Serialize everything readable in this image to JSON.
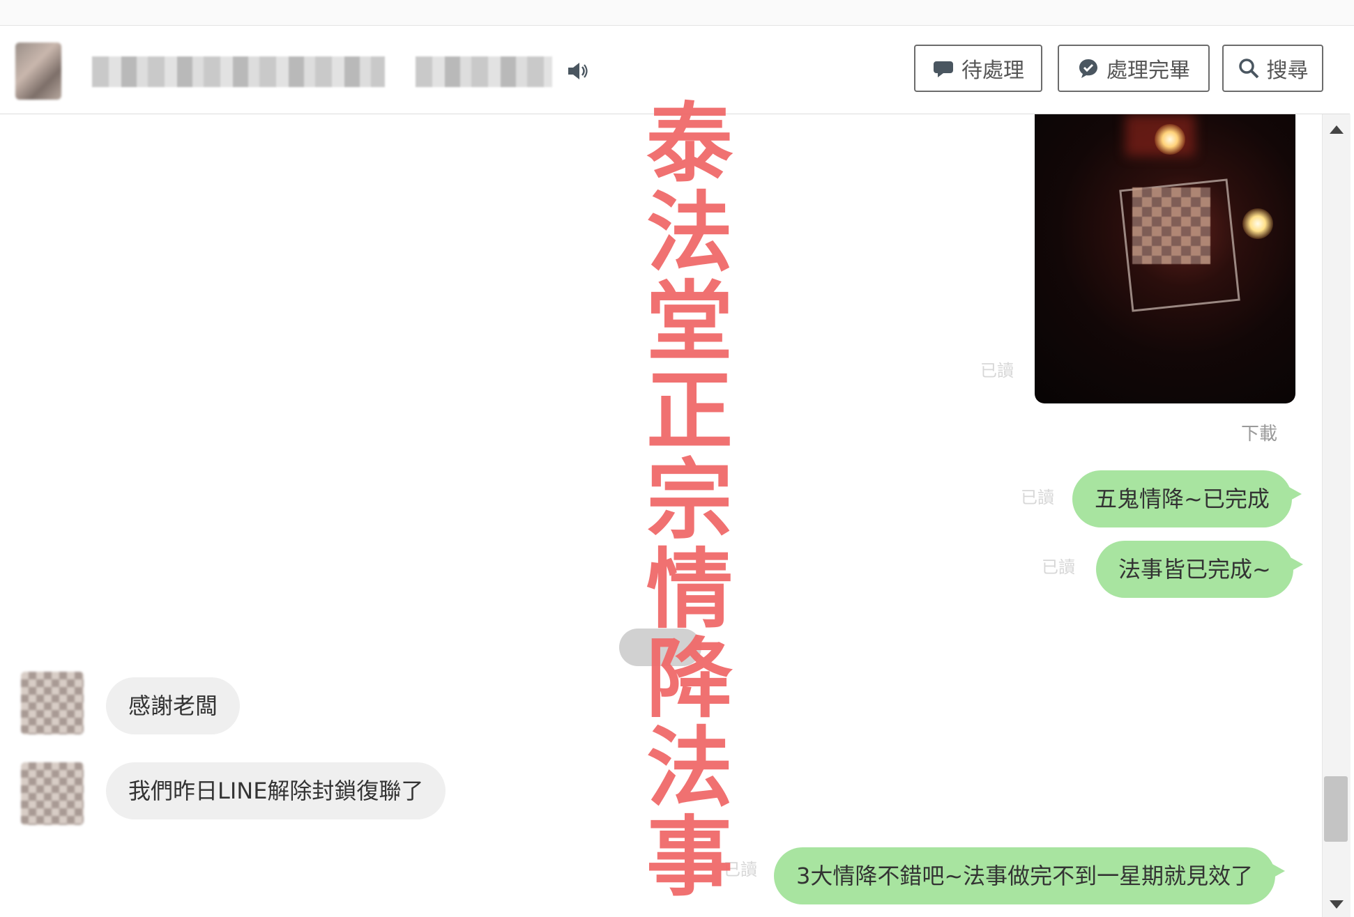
{
  "header": {
    "buttons": [
      {
        "label": "待處理",
        "icon": "chat-bubble-icon"
      },
      {
        "label": "處理完畢",
        "icon": "chat-check-icon"
      },
      {
        "label": "搜尋",
        "icon": "search-icon"
      }
    ]
  },
  "chat": {
    "download_label": "下載",
    "read_label": "已讀",
    "messages": [
      {
        "side": "out",
        "text": "五鬼情降~已完成"
      },
      {
        "side": "out",
        "text": "法事皆已完成~"
      },
      {
        "side": "in",
        "text": "感謝老闆"
      },
      {
        "side": "in",
        "text": "我們昨日LINE解除封鎖復聯了"
      },
      {
        "side": "out",
        "text": "3大情降不錯吧~法事做完不到一星期就見效了"
      }
    ]
  },
  "watermark": {
    "text": "泰法堂正宗情降法事"
  },
  "colors": {
    "outgoing_bubble": "#a8e4a0",
    "incoming_bubble": "#efefef",
    "watermark": "#f06a6a"
  }
}
